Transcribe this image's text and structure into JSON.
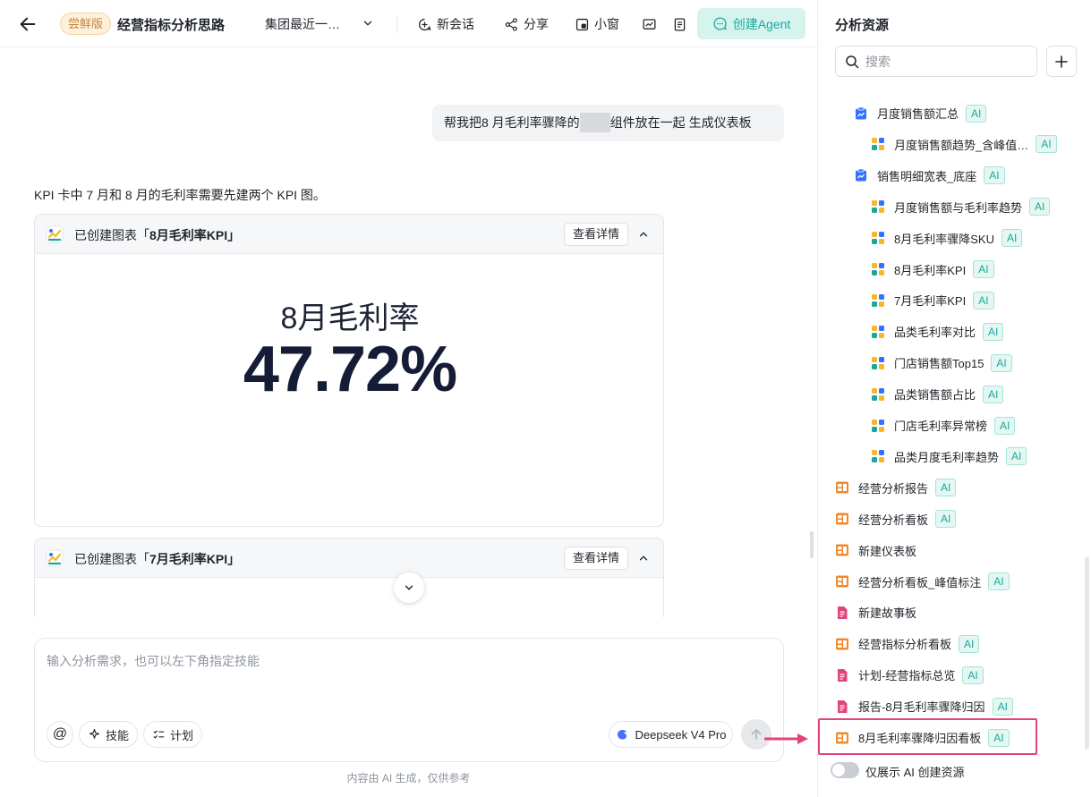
{
  "header": {
    "trial_badge": "尝鲜版",
    "title": "经营指标分析思路",
    "dataset": "集团最近一…",
    "new_chat": "新会话",
    "share": "分享",
    "mini_window": "小窗",
    "create_agent": "创建Agent"
  },
  "chat": {
    "user_message_before": "帮我把8 月毛利率骤降的",
    "user_message_after": "组件放在一起 生成仪表板",
    "ai_message": "KPI 卡中 7 月和 8 月的毛利率需要先建两个 KPI 图。",
    "cards": [
      {
        "prefix": "已创建图表「",
        "name": "8月毛利率KPI",
        "suffix": "」",
        "detail": "查看详情",
        "kpi_label": "8月毛利率",
        "kpi_value": "47.72%"
      },
      {
        "prefix": "已创建图表「",
        "name": "7月毛利率KPI",
        "suffix": "」",
        "detail": "查看详情"
      }
    ]
  },
  "composer": {
    "placeholder": "输入分析需求，也可以左下角指定技能",
    "at": "@",
    "skill": "技能",
    "plan": "计划",
    "model": "Deepseek V4 Pro",
    "disclaimer": "内容由 AI 生成，仅供参考"
  },
  "sidebar": {
    "title": "分析资源",
    "search_placeholder": "搜索",
    "ai_tag": "AI",
    "items": [
      {
        "label": "月度销售额汇总",
        "type": "dataset",
        "ai": true
      },
      {
        "label": "月度销售额趋势_含峰值…",
        "type": "chart",
        "ai": true
      },
      {
        "label": "销售明细宽表_底座",
        "type": "dataset",
        "ai": true
      },
      {
        "label": "月度销售额与毛利率趋势",
        "type": "chart",
        "ai": true
      },
      {
        "label": "8月毛利率骤降SKU",
        "type": "chart",
        "ai": true
      },
      {
        "label": "8月毛利率KPI",
        "type": "chart",
        "ai": true
      },
      {
        "label": "7月毛利率KPI",
        "type": "chart",
        "ai": true
      },
      {
        "label": "品类毛利率对比",
        "type": "chart",
        "ai": true
      },
      {
        "label": "门店销售额Top15",
        "type": "chart",
        "ai": true
      },
      {
        "label": "品类销售额占比",
        "type": "chart",
        "ai": true
      },
      {
        "label": "门店毛利率异常榜",
        "type": "chart",
        "ai": true
      },
      {
        "label": "品类月度毛利率趋势",
        "type": "chart",
        "ai": true
      },
      {
        "label": "经营分析报告",
        "type": "dashboard",
        "ai": true
      },
      {
        "label": "经营分析看板",
        "type": "dashboard",
        "ai": true
      },
      {
        "label": "新建仪表板",
        "type": "dashboard",
        "ai": false
      },
      {
        "label": "经营分析看板_峰值标注",
        "type": "dashboard",
        "ai": true
      },
      {
        "label": "新建故事板",
        "type": "report",
        "ai": false
      },
      {
        "label": "经营指标分析看板",
        "type": "dashboard",
        "ai": true
      },
      {
        "label": "计划-经营指标总览",
        "type": "report",
        "ai": true
      },
      {
        "label": "报告-8月毛利率骤降归因",
        "type": "report",
        "ai": true
      },
      {
        "label": "8月毛利率骤降归因看板",
        "type": "dashboard",
        "ai": true
      }
    ],
    "toggle_label": "仅展示 AI 创建资源"
  },
  "colors": {
    "accent": "#1aa89a",
    "highlight": "#e2437a",
    "dashboard_icon": "#f0892b",
    "report_icon": "#e2437a",
    "dataset_icon": "#3370ff"
  }
}
